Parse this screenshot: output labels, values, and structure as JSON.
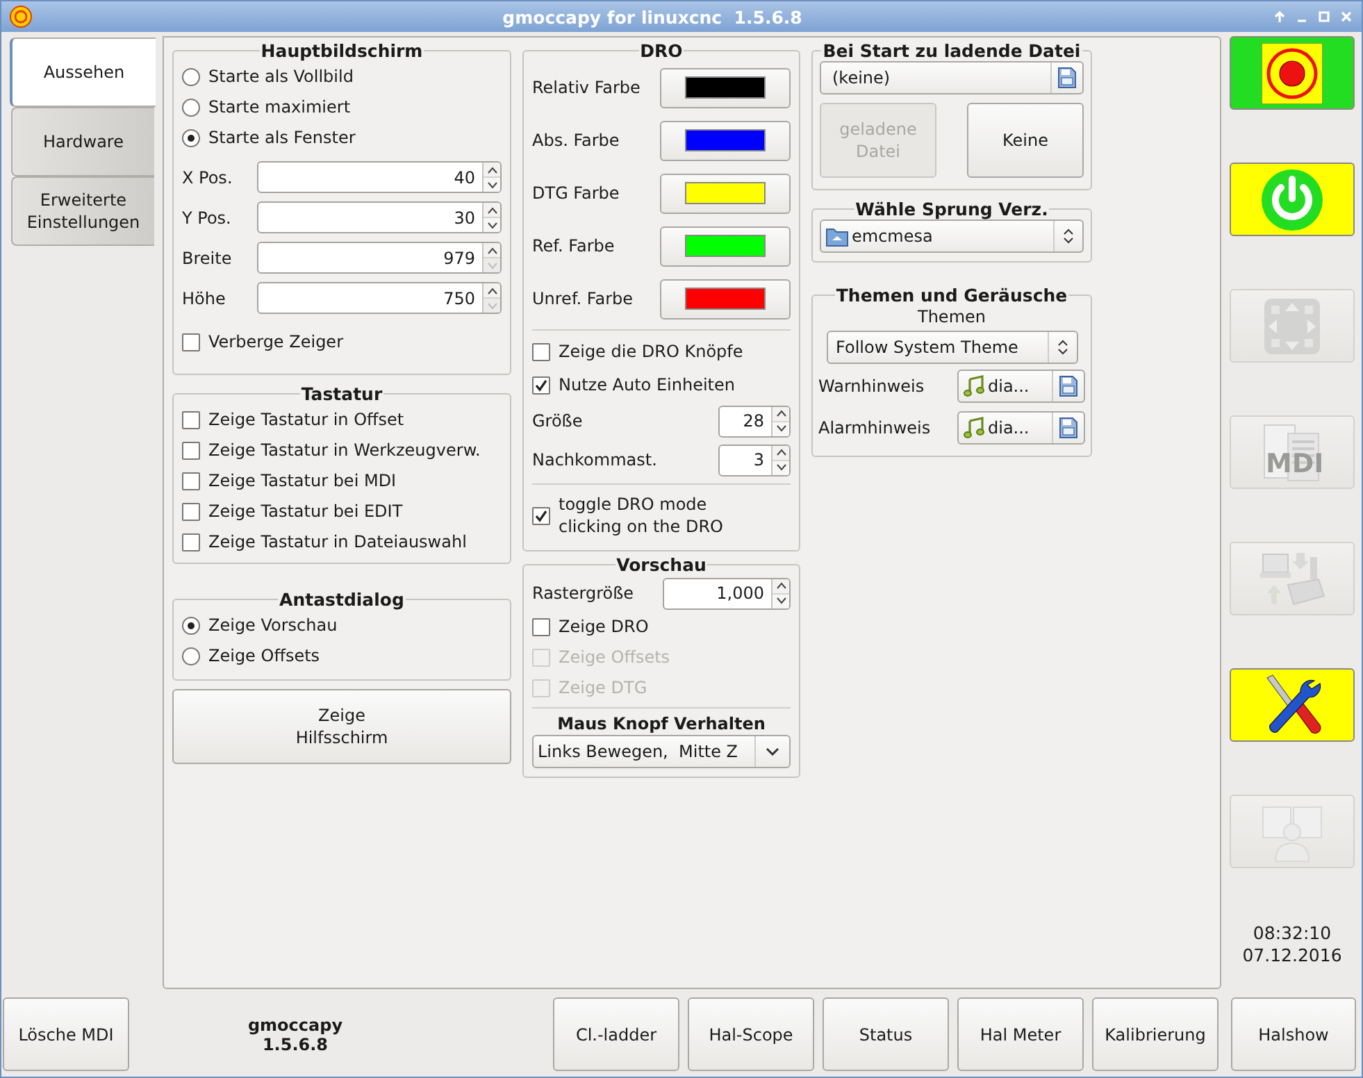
{
  "window": {
    "title": "gmoccapy for linuxcnc  1.5.6.8"
  },
  "tabs": [
    {
      "label": "Aussehen",
      "selected": true
    },
    {
      "label": "Hardware",
      "selected": false
    },
    {
      "label": "Erweiterte\nEinstellungen",
      "selected": false
    }
  ],
  "hauptbildschirm": {
    "title": "Hauptbildschirm",
    "modes": [
      {
        "label": "Starte als Vollbild",
        "selected": false
      },
      {
        "label": "Starte maximiert",
        "selected": false
      },
      {
        "label": "Starte als Fenster",
        "selected": true
      }
    ],
    "fields": [
      {
        "label": "X Pos.",
        "value": "40",
        "down_disabled": false
      },
      {
        "label": "Y Pos.",
        "value": "30",
        "down_disabled": false
      },
      {
        "label": "Breite",
        "value": "979",
        "down_disabled": true
      },
      {
        "label": "Höhe",
        "value": "750",
        "down_disabled": true
      }
    ],
    "hide_pointer": {
      "label": "Verberge Zeiger",
      "checked": false
    }
  },
  "tastatur": {
    "title": "Tastatur",
    "options": [
      {
        "label": "Zeige Tastatur in Offset",
        "checked": false
      },
      {
        "label": "Zeige Tastatur in Werkzeugverw.",
        "checked": false
      },
      {
        "label": "Zeige Tastatur bei MDI",
        "checked": false
      },
      {
        "label": "Zeige Tastatur bei EDIT",
        "checked": false
      },
      {
        "label": "Zeige Tastatur in Dateiauswahl",
        "checked": false
      }
    ]
  },
  "antastdialog": {
    "title": "Antastdialog",
    "options": [
      {
        "label": "Zeige Vorschau",
        "selected": true
      },
      {
        "label": "Zeige Offsets",
        "selected": false
      }
    ]
  },
  "help_button": "Zeige\nHilfsschirm",
  "dro": {
    "title": "DRO",
    "colors": [
      {
        "label": "Relativ Farbe",
        "color": "#000000"
      },
      {
        "label": "Abs. Farbe",
        "color": "#0000ff"
      },
      {
        "label": "DTG Farbe",
        "color": "#ffff00"
      },
      {
        "label": "Ref. Farbe",
        "color": "#00ff00"
      },
      {
        "label": "Unref. Farbe",
        "color": "#ff0000"
      }
    ],
    "options": [
      {
        "label": "Zeige die DRO Knöpfe",
        "checked": false
      },
      {
        "label": "Nutze Auto Einheiten",
        "checked": true
      }
    ],
    "spins": [
      {
        "label": "Größe",
        "value": "28"
      },
      {
        "label": "Nachkommast.",
        "value": "3"
      }
    ],
    "toggle": {
      "label": "toggle DRO mode\nclicking on the DRO",
      "checked": true
    }
  },
  "vorschau": {
    "title": "Vorschau",
    "grid": {
      "label": "Rastergröße",
      "value": "1,000"
    },
    "options": [
      {
        "label": "Zeige DRO",
        "checked": false,
        "disabled": false
      },
      {
        "label": "Zeige Offsets",
        "checked": false,
        "disabled": true
      },
      {
        "label": "Zeige DTG",
        "checked": false,
        "disabled": true
      }
    ],
    "mouse": {
      "title": "Maus Knopf Verhalten",
      "value": "Links Bewegen,  Mitte Z"
    }
  },
  "start_file": {
    "title": "Bei Start zu ladende Datei",
    "file": "(keine)",
    "buttons": [
      {
        "label": "geladene\nDatei",
        "disabled": true
      },
      {
        "label": "Keine",
        "disabled": false
      }
    ]
  },
  "jump_dir": {
    "title": "Wähle Sprung Verz.",
    "value": "emcmesa"
  },
  "themes": {
    "title": "Themen und Geräusche",
    "theme_label": "Themen",
    "theme": "Follow System Theme",
    "sounds": [
      {
        "label": "Warnhinweis",
        "value": "dia..."
      },
      {
        "label": "Alarmhinweis",
        "value": "dia..."
      }
    ]
  },
  "side_buttons": [
    {
      "kind": "estop",
      "color": "#22dd22",
      "disabled": false
    },
    {
      "kind": "power",
      "color": "#ffff00",
      "disabled": false
    },
    {
      "kind": "jog",
      "disabled": true
    },
    {
      "kind": "mdi",
      "label": "MDI",
      "disabled": true
    },
    {
      "kind": "auto",
      "disabled": true
    },
    {
      "kind": "settings",
      "color": "#ffff00",
      "disabled": false
    },
    {
      "kind": "user",
      "disabled": true
    }
  ],
  "clock": {
    "time": "08:32:10",
    "date": "07.12.2016"
  },
  "bottom": {
    "left_button": "Lösche MDI",
    "version": {
      "name": "gmoccapy",
      "number": "1.5.6.8"
    },
    "buttons": [
      "Cl.-ladder",
      "Hal-Scope",
      "Status",
      "Hal Meter",
      "Kalibrierung"
    ],
    "right_button": "Halshow"
  }
}
